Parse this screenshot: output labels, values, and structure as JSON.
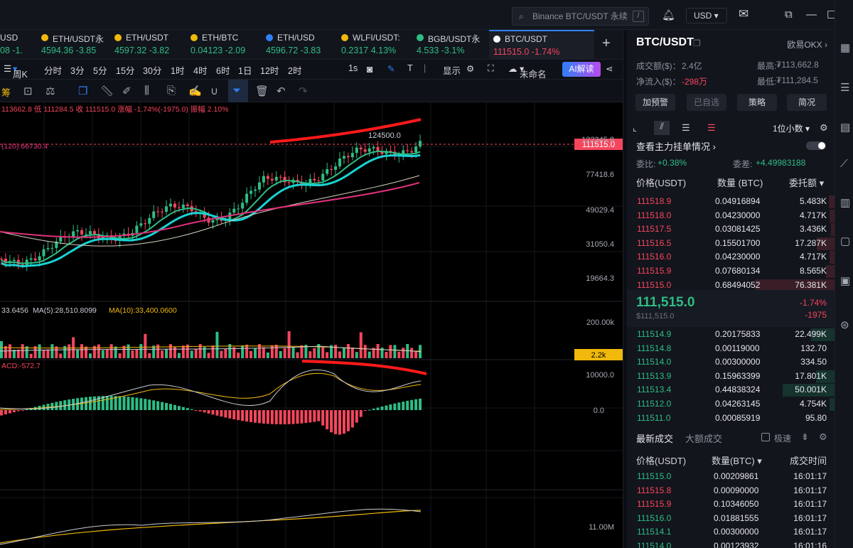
{
  "topbar": {
    "search_placeholder": "Binance BTC/USDT 永续",
    "currency": "USD",
    "icons": [
      "search-icon",
      "bell-icon",
      "mail-icon",
      "window-icon",
      "minimize-icon",
      "maximize-icon"
    ]
  },
  "tabs": [
    {
      "name": "USD",
      "price": "08",
      "change": "-1.",
      "color": "green"
    },
    {
      "name": "ETH/USDT永",
      "price": "4594.36",
      "change": "-3.85",
      "color": "green"
    },
    {
      "name": "ETH/USDT",
      "price": "4597.32",
      "change": "-3.82",
      "color": "green"
    },
    {
      "name": "ETH/BTC",
      "price": "0.04123",
      "change": "-2.09",
      "color": "green"
    },
    {
      "name": "ETH/USD",
      "price": "4596.72",
      "change": "-3.83",
      "color": "green"
    },
    {
      "name": "WLFI/USDT:",
      "price": "0.2317",
      "change": "4.13%",
      "color": "green"
    },
    {
      "name": "BGB/USDT永",
      "price": "4.533",
      "change": "-3.1%",
      "color": "green"
    },
    {
      "name": "BTC/USDT",
      "price": "111515.0",
      "change": "-1.74%",
      "color": "red"
    }
  ],
  "toolbar": {
    "period_selected": "周K",
    "periods": [
      "分时",
      "3分",
      "5分",
      "15分",
      "30分",
      "1时",
      "4时",
      "6时",
      "1日",
      "12时",
      "2时"
    ],
    "refresh": "1s",
    "display": "显示",
    "unnamed": "未命名",
    "ai": "AI解读"
  },
  "chart": {
    "ohlc_line": "113662.8 低 111284.5 收 111515.0 涨幅 -1.74%(-1975.0) 振幅 2.10%",
    "ma_line": "(120):66730.4",
    "price_label": "111515.0",
    "high_label": "124500.0",
    "y_ticks": [
      "122345.8",
      "77418.6",
      "49029.4",
      "31050.4",
      "19664.3"
    ],
    "vol_legend_a": "33.6456",
    "vol_legend_b": "MA(5):28,510.8099",
    "vol_legend_c": "MA(10):33,400.0600",
    "vol_ticks": [
      "200.00k"
    ],
    "vol_label": "2.2k",
    "macd_legend": "ACD:-572.7",
    "macd_ticks": [
      "10000.0",
      "0.0"
    ],
    "bottom_tick": "11.00M",
    "left_partial": "筹"
  },
  "panel": {
    "pair": "BTC/USDT",
    "exchange": "欧易OKX",
    "turnover_label": "成交额($)：",
    "turnover": "2.4亿",
    "inflow_label": "净流入($)：",
    "inflow": "-298万",
    "high_label": "最高:",
    "high": "₮113,662.8",
    "low_label": "最低:",
    "low": "₮111,284.5",
    "buttons": [
      "加预警",
      "已自选",
      "策略",
      "简况"
    ],
    "decimals": "1位小数",
    "main_orders": "查看主力挂单情况",
    "ratio_label": "委比:",
    "ratio": "+0.38%",
    "diff_label": "委差:",
    "diff": "+4.49983188",
    "headers": [
      "价格(USDT)",
      "数量 (BTC)",
      "委托额"
    ],
    "asks": [
      {
        "p": "111518.9",
        "q": "0.04916894",
        "t": "5.483K"
      },
      {
        "p": "111518.0",
        "q": "0.04230000",
        "t": "4.717K"
      },
      {
        "p": "111517.5",
        "q": "0.03081425",
        "t": "3.436K"
      },
      {
        "p": "111516.5",
        "q": "0.15501700",
        "t": "17.287K"
      },
      {
        "p": "111516.0",
        "q": "0.04230000",
        "t": "4.717K"
      },
      {
        "p": "111515.9",
        "q": "0.07680134",
        "t": "8.565K"
      },
      {
        "p": "111515.0",
        "q": "0.68494052",
        "t": "76.381K"
      }
    ],
    "last": "111,515.0",
    "last_usd": "$111,515.0",
    "chg_pct": "-1.74%",
    "chg_abs": "-1975",
    "bids": [
      {
        "p": "111514.9",
        "q": "0.20175833",
        "t": "22.499K"
      },
      {
        "p": "111514.8",
        "q": "0.00119000",
        "t": "132.70"
      },
      {
        "p": "111514.0",
        "q": "0.00300000",
        "t": "334.50"
      },
      {
        "p": "111513.9",
        "q": "0.15963399",
        "t": "17.801K"
      },
      {
        "p": "111513.4",
        "q": "0.44838324",
        "t": "50.001K"
      },
      {
        "p": "111512.0",
        "q": "0.04263145",
        "t": "4.754K"
      },
      {
        "p": "111511.0",
        "q": "0.00085919",
        "t": "95.80"
      }
    ],
    "trades_tab1": "最新成交",
    "trades_tab2": "大额成交",
    "fast": "极速",
    "trade_headers": [
      "价格(USDT)",
      "数量(BTC)",
      "成交时间"
    ],
    "trades": [
      {
        "p": "111515.0",
        "q": "0.00209861",
        "t": "16:01:17",
        "c": "green"
      },
      {
        "p": "111515.8",
        "q": "0.00090000",
        "t": "16:01:17",
        "c": "red"
      },
      {
        "p": "111515.9",
        "q": "0.10346050",
        "t": "16:01:17",
        "c": "red"
      },
      {
        "p": "111516.0",
        "q": "0.01881555",
        "t": "16:01:17",
        "c": "green"
      },
      {
        "p": "111514.1",
        "q": "0.00300000",
        "t": "16:01:17",
        "c": "green"
      },
      {
        "p": "111514.0",
        "q": "0.00123932",
        "t": "16:01:16",
        "c": "green"
      }
    ]
  },
  "colors": {
    "up": "#2ebd85",
    "down": "#f6465d",
    "accent": "#2f7ff6"
  }
}
